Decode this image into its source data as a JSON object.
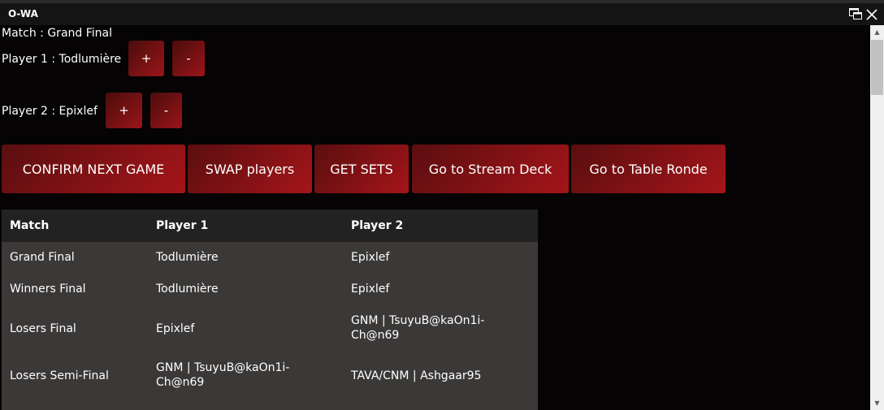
{
  "window": {
    "title": "O-WA",
    "restore_icon": "restore-icon",
    "close_icon": "close-icon"
  },
  "match_info": {
    "match_label": "Match : Grand Final",
    "player1_label": "Player 1 : Todlumière",
    "player2_label": "Player 2 : Epixlef",
    "plus_label": "+",
    "minus_label": "-"
  },
  "actions": {
    "confirm_next_game": "CONFIRM NEXT GAME",
    "swap_players": "SWAP players",
    "get_sets": "GET SETS",
    "go_stream_deck": "Go to Stream Deck",
    "go_table_ronde": "Go to Table Ronde"
  },
  "table": {
    "headers": [
      "Match",
      "Player 1",
      "Player 2"
    ],
    "rows": [
      [
        "Grand Final",
        "Todlumière",
        "Epixlef"
      ],
      [
        "Winners Final",
        "Todlumière",
        "Epixlef"
      ],
      [
        "Losers Final",
        "Epixlef",
        "GNM | TsuyuB@kaOn1i-Ch@n69"
      ],
      [
        "Losers Semi-Final",
        "GNM | TsuyuB@kaOn1i-Ch@n69",
        "TAVA/CNM | Ashgaar95"
      ]
    ]
  },
  "colors": {
    "background": "#050303",
    "button_dark": "#4a0c0d",
    "button_accent": "#a51519",
    "table_bg": "#3b3938",
    "table_header_bg": "#232222"
  }
}
